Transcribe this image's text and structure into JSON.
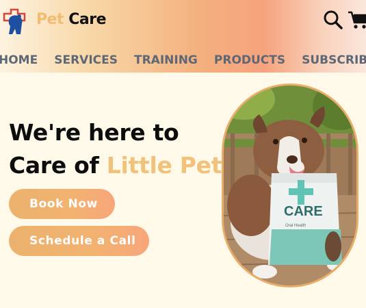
{
  "brand": {
    "word1": "Pet",
    "word2": "Care",
    "logo_icon": "pet-care-logo-icon"
  },
  "header": {
    "search_icon": "search-icon",
    "cart_icon": "cart-icon"
  },
  "nav": {
    "items": [
      "HOME",
      "SERVICES",
      "TRAINING",
      "PRODUCTS",
      "SUBSCRIBE"
    ]
  },
  "hero": {
    "line1": "We're here to",
    "line2_prefix": "Care of ",
    "line2_highlight": "Little Pets",
    "book_label": "Book Now",
    "call_label": "Schedule a Call",
    "image_icon": "dog-with-food-bag-image",
    "bag_brand": "CARE",
    "bag_caption": "Oral Health"
  },
  "colors": {
    "accent": "#f0bd72",
    "button": "#f0b06f",
    "nav_text": "#5e6775",
    "page_bg": "#fef9e8"
  }
}
